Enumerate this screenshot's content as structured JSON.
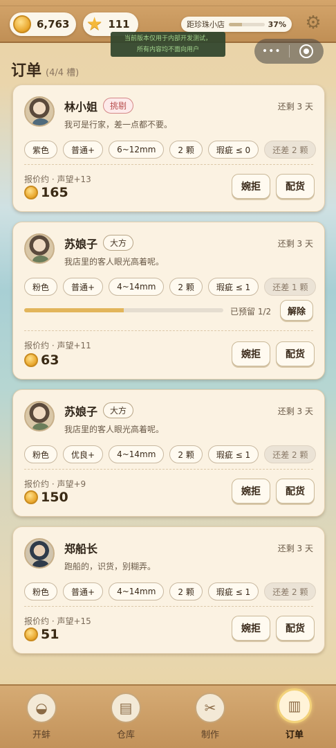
{
  "header": {
    "coins": "6,763",
    "stars": "111",
    "progress_label": "距珍珠小店",
    "progress_percent": "37%",
    "progress_value": 37,
    "banner_line1": "当前版本仅用于内部开发测试，",
    "banner_line2": "所有内容均不面向用户"
  },
  "page": {
    "title": "订单",
    "slots": "(4/4 槽)"
  },
  "orders": [
    {
      "name": "林小姐",
      "trait": "挑剔",
      "due": "还剩 3 天",
      "quote": "我可是行家，差一点都不要。",
      "chips": [
        "紫色",
        "普通+",
        "6~12mm",
        "2 颗",
        "瑕疵 ≤ 0"
      ],
      "shortage": "还差 2 颗",
      "meta": "报价约 · 声望+13",
      "price": "165",
      "reject": "婉拒",
      "deliver": "配货"
    },
    {
      "name": "苏娘子",
      "trait": "大方",
      "due": "还剩 3 天",
      "quote": "我店里的客人眼光高着呢。",
      "chips": [
        "粉色",
        "普通+",
        "4~14mm",
        "2 颗",
        "瑕疵 ≤ 1"
      ],
      "shortage": "还差 1 颗",
      "reserved": "已预留 1/2",
      "reserved_fraction": 0.5,
      "release": "解除",
      "meta": "报价约 · 声望+11",
      "price": "63",
      "reject": "婉拒",
      "deliver": "配货"
    },
    {
      "name": "苏娘子",
      "trait": "大方",
      "due": "还剩 3 天",
      "quote": "我店里的客人眼光高着呢。",
      "chips": [
        "粉色",
        "优良+",
        "4~14mm",
        "2 颗",
        "瑕疵 ≤ 1"
      ],
      "shortage": "还差 2 颗",
      "meta": "报价约 · 声望+9",
      "price": "150",
      "reject": "婉拒",
      "deliver": "配货"
    },
    {
      "name": "郑船长",
      "trait": "",
      "due": "还剩 3 天",
      "quote": "跑船的，识货，别糊弄。",
      "chips": [
        "粉色",
        "普通+",
        "4~14mm",
        "2 颗",
        "瑕疵 ≤ 1"
      ],
      "shortage": "还差 2 颗",
      "meta": "报价约 · 声望+15",
      "price": "51",
      "reject": "婉拒",
      "deliver": "配货"
    }
  ],
  "nav": [
    {
      "label": "开蚌",
      "icon": "clam-icon"
    },
    {
      "label": "仓库",
      "icon": "basket-icon"
    },
    {
      "label": "制作",
      "icon": "tools-icon"
    },
    {
      "label": "订单",
      "icon": "scroll-icon",
      "active": true
    }
  ],
  "colors": {
    "accent": "#e2b55b",
    "picky": "#b84e4e"
  }
}
